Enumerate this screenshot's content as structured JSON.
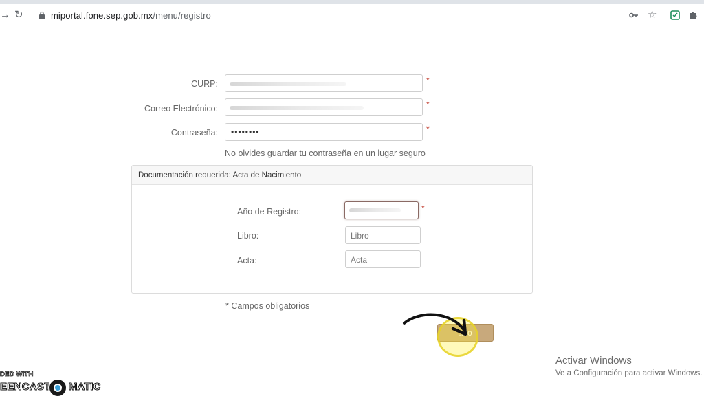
{
  "browser": {
    "url_domain": "miportal.fone.sep.gob.mx",
    "url_path": "/menu/registro",
    "back_icon": "arrow-right",
    "reload_icon": "reload",
    "lock_icon": "lock",
    "key_icon": "key",
    "star_icon": "star",
    "ext_icon": "extension",
    "puzzle_icon": "puzzle"
  },
  "form": {
    "curp_label": "CURP:",
    "email_label": "Correo Electrónico:",
    "password_label": "Contraseña:",
    "password_value": "••••••••",
    "required_mark": "*",
    "password_hint": "No olvides guardar tu contraseña en un lugar seguro"
  },
  "documentation": {
    "title": "Documentación requerida: Acta de Nacimiento",
    "year_label": "Año de Registro:",
    "libro_label": "Libro:",
    "libro_placeholder": "Libro",
    "acta_label": "Acta:",
    "acta_placeholder": "Acta"
  },
  "footer": {
    "required_note": "* Campos obligatorios",
    "submit_label": "...lo"
  },
  "windows": {
    "activate_title": "Activar Windows",
    "activate_subtitle": "Ve a Configuración para activar Windows."
  },
  "watermark": {
    "line1": "DED WITH",
    "line2a": "EENCAST",
    "line2b": "MATIC"
  },
  "colors": {
    "button": "#c8a97c",
    "required": "#c0392b",
    "highlight": "#f0dc28"
  }
}
